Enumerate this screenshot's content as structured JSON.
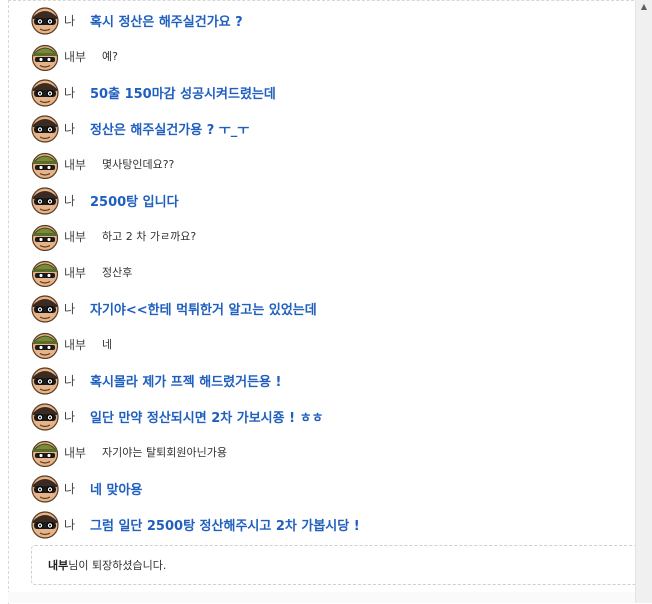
{
  "chat": {
    "messages": [
      {
        "speaker": "나",
        "from": "me",
        "text": "혹시 정산은 해주실건가요 ?"
      },
      {
        "speaker": "내부",
        "from": "other",
        "text": "예?"
      },
      {
        "speaker": "나",
        "from": "me",
        "text": "50출 150마감 성공시켜드렸는데"
      },
      {
        "speaker": "나",
        "from": "me",
        "text": "정산은 해주실건가용 ? ㅜ_ㅜ"
      },
      {
        "speaker": "내부",
        "from": "other",
        "text": "몇사탕인데요??"
      },
      {
        "speaker": "나",
        "from": "me",
        "text": "2500탕 입니다"
      },
      {
        "speaker": "내부",
        "from": "other",
        "text": "하고 2 차 가ㄹ까요?"
      },
      {
        "speaker": "내부",
        "from": "other",
        "text": "정산후"
      },
      {
        "speaker": "나",
        "from": "me",
        "text": "자기야<<한테 먹튀한거 알고는 있었는데"
      },
      {
        "speaker": "내부",
        "from": "other",
        "text": "네"
      },
      {
        "speaker": "나",
        "from": "me",
        "text": "혹시몰라 제가 프젝 해드렸거든용 !"
      },
      {
        "speaker": "나",
        "from": "me",
        "text": "일단 만약 정산되시면 2차 가보시죵 ! ㅎㅎ"
      },
      {
        "speaker": "내부",
        "from": "other",
        "text": "자기야는 탈퇴회원아닌가용"
      },
      {
        "speaker": "나",
        "from": "me",
        "text": "네 맞아용"
      },
      {
        "speaker": "나",
        "from": "me",
        "text": "그럼 일단 2500탕 정산해주시고 2차 가봅시당 !"
      }
    ],
    "notice": {
      "name": "내부",
      "text": "님이 퇴장하셨습니다."
    }
  },
  "colors": {
    "me_text": "#1f5fbf",
    "other_text": "#333333"
  },
  "icons": {
    "me_avatar": "sunglasses-avatar-icon",
    "other_avatar": "green-cap-avatar-icon"
  }
}
